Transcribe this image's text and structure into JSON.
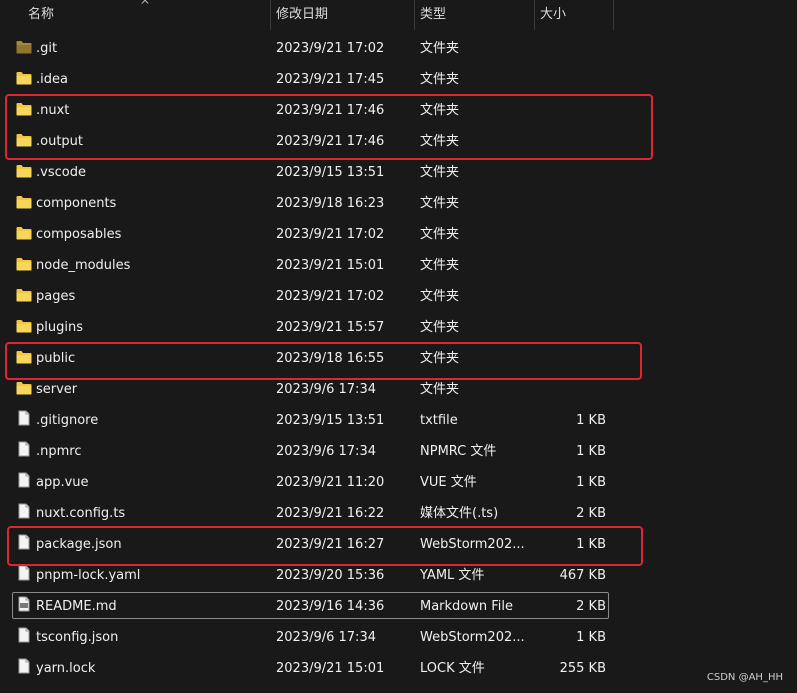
{
  "columns": {
    "name": "名称",
    "modified": "修改日期",
    "type": "类型",
    "size": "大小"
  },
  "files": [
    {
      "name": ".git",
      "modified": "2023/9/21 17:02",
      "type": "文件夹",
      "size": "",
      "icon": "folder-icon-dim"
    },
    {
      "name": ".idea",
      "modified": "2023/9/21 17:45",
      "type": "文件夹",
      "size": "",
      "icon": "folder-icon"
    },
    {
      "name": ".nuxt",
      "modified": "2023/9/21 17:46",
      "type": "文件夹",
      "size": "",
      "icon": "folder-icon"
    },
    {
      "name": ".output",
      "modified": "2023/9/21 17:46",
      "type": "文件夹",
      "size": "",
      "icon": "folder-icon"
    },
    {
      "name": ".vscode",
      "modified": "2023/9/15 13:51",
      "type": "文件夹",
      "size": "",
      "icon": "folder-icon"
    },
    {
      "name": "components",
      "modified": "2023/9/18 16:23",
      "type": "文件夹",
      "size": "",
      "icon": "folder-icon"
    },
    {
      "name": "composables",
      "modified": "2023/9/21 17:02",
      "type": "文件夹",
      "size": "",
      "icon": "folder-icon"
    },
    {
      "name": "node_modules",
      "modified": "2023/9/21 15:01",
      "type": "文件夹",
      "size": "",
      "icon": "folder-icon"
    },
    {
      "name": "pages",
      "modified": "2023/9/21 17:02",
      "type": "文件夹",
      "size": "",
      "icon": "folder-icon"
    },
    {
      "name": "plugins",
      "modified": "2023/9/21 15:57",
      "type": "文件夹",
      "size": "",
      "icon": "folder-icon"
    },
    {
      "name": "public",
      "modified": "2023/9/18 16:55",
      "type": "文件夹",
      "size": "",
      "icon": "folder-icon"
    },
    {
      "name": "server",
      "modified": "2023/9/6 17:34",
      "type": "文件夹",
      "size": "",
      "icon": "folder-icon"
    },
    {
      "name": ".gitignore",
      "modified": "2023/9/15 13:51",
      "type": "txtfile",
      "size": "1 KB",
      "icon": "file-icon"
    },
    {
      "name": ".npmrc",
      "modified": "2023/9/6 17:34",
      "type": "NPMRC 文件",
      "size": "1 KB",
      "icon": "file-icon"
    },
    {
      "name": "app.vue",
      "modified": "2023/9/21 11:20",
      "type": "VUE 文件",
      "size": "1 KB",
      "icon": "file-icon"
    },
    {
      "name": "nuxt.config.ts",
      "modified": "2023/9/21 16:22",
      "type": "媒体文件(.ts)",
      "size": "2 KB",
      "icon": "file-icon"
    },
    {
      "name": "package.json",
      "modified": "2023/9/21 16:27",
      "type": "WebStorm202...",
      "size": "1 KB",
      "icon": "file-icon"
    },
    {
      "name": "pnpm-lock.yaml",
      "modified": "2023/9/20 15:36",
      "type": "YAML 文件",
      "size": "467 KB",
      "icon": "file-icon"
    },
    {
      "name": "README.md",
      "modified": "2023/9/16 14:36",
      "type": "Markdown File",
      "size": "2 KB",
      "icon": "markdown-file-icon",
      "selected": true
    },
    {
      "name": "tsconfig.json",
      "modified": "2023/9/6 17:34",
      "type": "WebStorm202...",
      "size": "1 KB",
      "icon": "file-icon"
    },
    {
      "name": "yarn.lock",
      "modified": "2023/9/21 15:01",
      "type": "LOCK 文件",
      "size": "255 KB",
      "icon": "file-icon"
    }
  ],
  "highlights": [
    {
      "rows": [
        ".nuxt",
        ".output"
      ],
      "color": "#e02431"
    },
    {
      "rows": [
        "public"
      ],
      "color": "#e02431"
    },
    {
      "rows": [
        "package.json"
      ],
      "color": "#e02431"
    }
  ],
  "colors": {
    "background": "#191919",
    "text": "#f0f0f0",
    "folder": "#f4c542",
    "highlight": "#e02431"
  },
  "watermark": "CSDN @AH_HH"
}
